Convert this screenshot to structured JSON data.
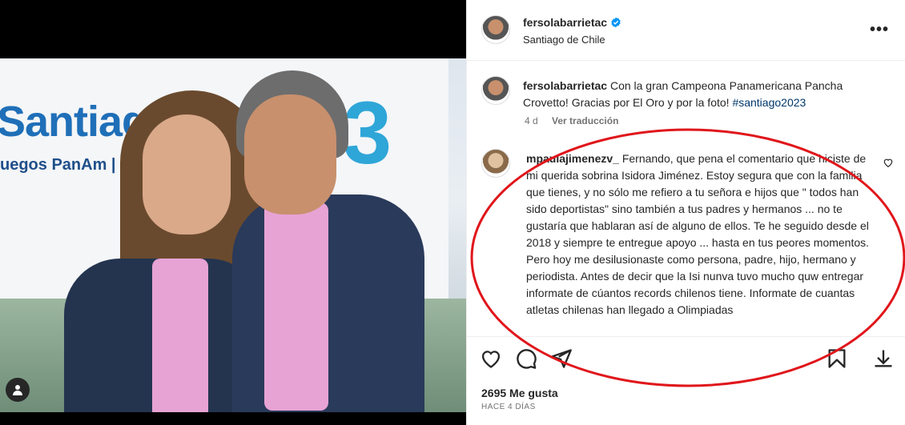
{
  "post": {
    "username": "fersolabarrietac",
    "location": "Santiago de Chile",
    "photo_sign": {
      "text": "Santiag",
      "sub": "uegos PanAm  |  Para",
      "number": "3"
    }
  },
  "caption": {
    "username": "fersolabarrietac",
    "text": " Con la gran Campeona Panamericana Pancha Crovetto! Gracias por El Oro y por la foto! ",
    "hashtag": "#santiago2023",
    "age": "4 d",
    "translate": "Ver traducción"
  },
  "comment": {
    "username": "mpaulajimenezv_",
    "text": " Fernando, que pena el comentario que hiciste de mi querida sobrina Isidora Jiménez. Estoy segura que con la familia que tienes, y no sólo me refiero a tu señora e hijos que \" todos han sido deportistas\" sino también a tus padres y hermanos ... no te gustaría que hablaran así de alguno de ellos. Te he seguido desde el 2018 y siempre te entregue apoyo ... hasta en tus peores momentos. Pero hoy me desilusionaste como persona, padre, hijo, hermano y periodista. Antes de decir que la Isi nunva tuvo mucho quw entregar informate de cúantos records chilenos tiene. Informate de cuantas atletas chilenas han llegado a Olimpiadas"
  },
  "stats": {
    "likes": "2695 Me gusta",
    "date": "HACE 4 DÍAS"
  },
  "colors": {
    "verified": "#0095f6",
    "annotation": "#e0161b",
    "link": "#00376b"
  },
  "icons": [
    "heart-icon",
    "comment-icon",
    "share-icon",
    "bookmark-icon",
    "download-icon",
    "more-icon",
    "verified-icon",
    "user-tag-icon"
  ]
}
